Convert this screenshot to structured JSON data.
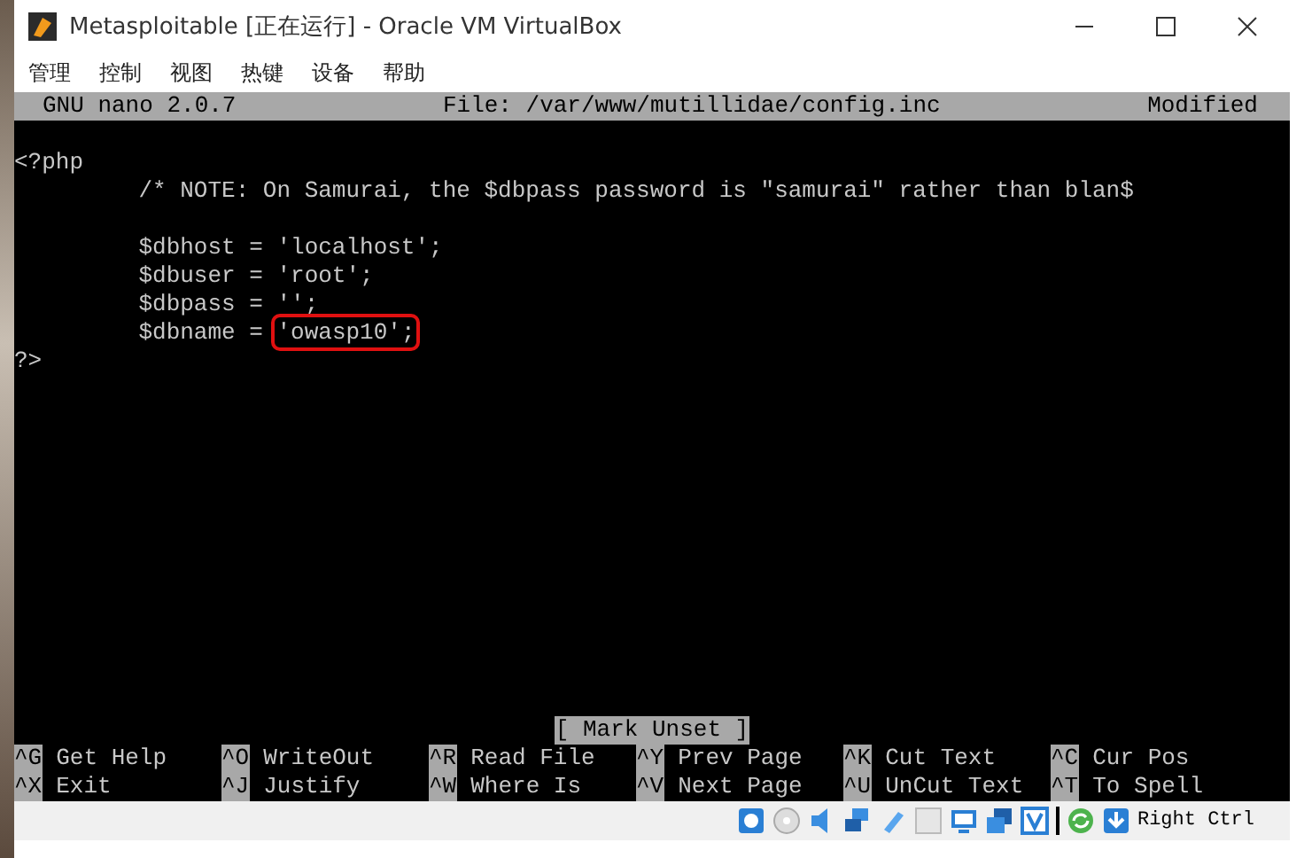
{
  "window": {
    "title": "Metasploitable [正在运行] - Oracle VM VirtualBox"
  },
  "menu": [
    "管理",
    "控制",
    "视图",
    "热键",
    "设备",
    "帮助"
  ],
  "nano": {
    "version": "GNU nano 2.0.7",
    "file": "File: /var/www/mutillidae/config.inc",
    "status": "Modified"
  },
  "lines": [
    {
      "text": "<?php",
      "blank_before": true
    },
    {
      "text": "         /* NOTE: On Samurai, the $dbpass password is \"samurai\" rather than blan$",
      "blank_before": false
    },
    {
      "text": "         $dbhost = 'localhost';",
      "blank_before": true
    },
    {
      "text": "         $dbuser = 'root';",
      "blank_before": false
    },
    {
      "text": "         $dbpass = '';",
      "blank_before": false
    },
    {
      "text": "         $dbname = ",
      "boxed": "'owasp10';",
      "blank_before": false
    },
    {
      "text": "?>",
      "blank_before": false
    }
  ],
  "message": "[ Mark Unset ]",
  "shortcuts": [
    {
      "key": "^G",
      "label": "Get Help"
    },
    {
      "key": "^O",
      "label": "WriteOut"
    },
    {
      "key": "^R",
      "label": "Read File"
    },
    {
      "key": "^Y",
      "label": "Prev Page"
    },
    {
      "key": "^K",
      "label": "Cut Text"
    },
    {
      "key": "^C",
      "label": "Cur Pos"
    },
    {
      "key": "^X",
      "label": "Exit"
    },
    {
      "key": "^J",
      "label": "Justify"
    },
    {
      "key": "^W",
      "label": "Where Is"
    },
    {
      "key": "^V",
      "label": "Next Page"
    },
    {
      "key": "^U",
      "label": "UnCut Text"
    },
    {
      "key": "^T",
      "label": "To Spell"
    }
  ],
  "status_bar": {
    "host_key": "Right Ctrl"
  }
}
